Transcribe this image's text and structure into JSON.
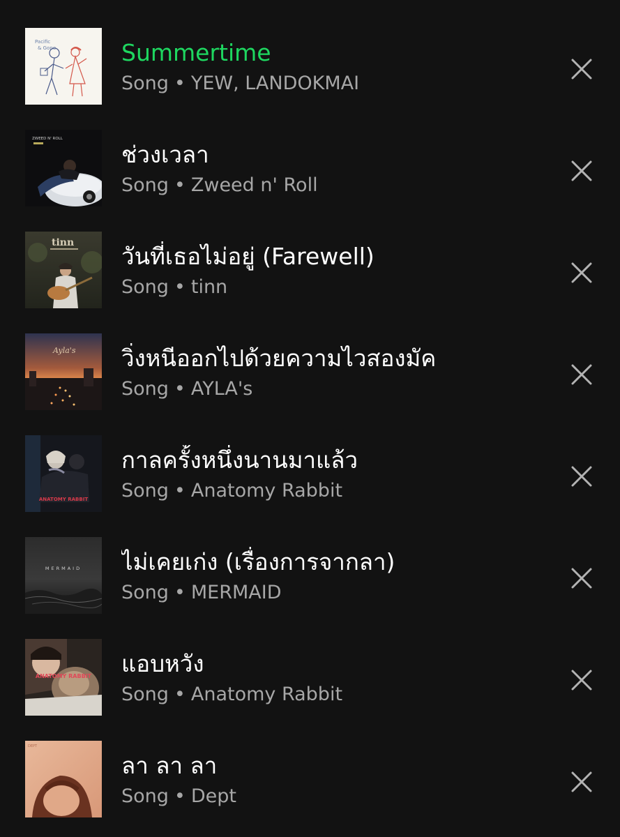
{
  "items": [
    {
      "title": "Summertime",
      "type": "Song",
      "separator": "•",
      "artist": "YEW, LANDOKMAI",
      "active": true,
      "remove_icon": "close-icon"
    },
    {
      "title": "ช่วงเวลา",
      "type": "Song",
      "separator": "•",
      "artist": "Zweed n' Roll",
      "active": false,
      "remove_icon": "close-icon"
    },
    {
      "title": "วันที่เธอไม่อยู่ (Farewell)",
      "type": "Song",
      "separator": "•",
      "artist": "tinn",
      "active": false,
      "remove_icon": "close-icon"
    },
    {
      "title": "วิ่งหนีออกไปด้วยความไวสองมัค",
      "type": "Song",
      "separator": "•",
      "artist": "AYLA's",
      "active": false,
      "remove_icon": "close-icon"
    },
    {
      "title": "กาลครั้งหนึ่งนานมาแล้ว",
      "type": "Song",
      "separator": "•",
      "artist": "Anatomy Rabbit",
      "active": false,
      "remove_icon": "close-icon"
    },
    {
      "title": "ไม่เคยเก่ง (เรื่องการจากลา)",
      "type": "Song",
      "separator": "•",
      "artist": "MERMAID",
      "active": false,
      "remove_icon": "close-icon"
    },
    {
      "title": "แอบหวัง",
      "type": "Song",
      "separator": "•",
      "artist": "Anatomy Rabbit",
      "active": false,
      "remove_icon": "close-icon"
    },
    {
      "title": "ลา ลา ลา",
      "type": "Song",
      "separator": "•",
      "artist": "Dept",
      "active": false,
      "remove_icon": "close-icon"
    }
  ],
  "artwork": {
    "art1": {
      "line1": "Pacific",
      "line2": "& Gone"
    },
    "art2": {
      "label": "ZWEED N' ROLL"
    },
    "art3": {
      "brand": "tinn"
    },
    "art4": {
      "brand": "Ayla's"
    },
    "art5": {
      "label": "ANATOMY RABBIT"
    },
    "art6": {
      "label": "MERMAID"
    },
    "art7": {
      "label": "ANATOMY RABBIT"
    },
    "art8": {
      "label": "DEPT"
    }
  },
  "colors": {
    "background": "#121212",
    "active_title": "#1ed760",
    "title": "#ffffff",
    "subtitle": "#a7a7a7",
    "close_icon": "#b3b3b3"
  }
}
